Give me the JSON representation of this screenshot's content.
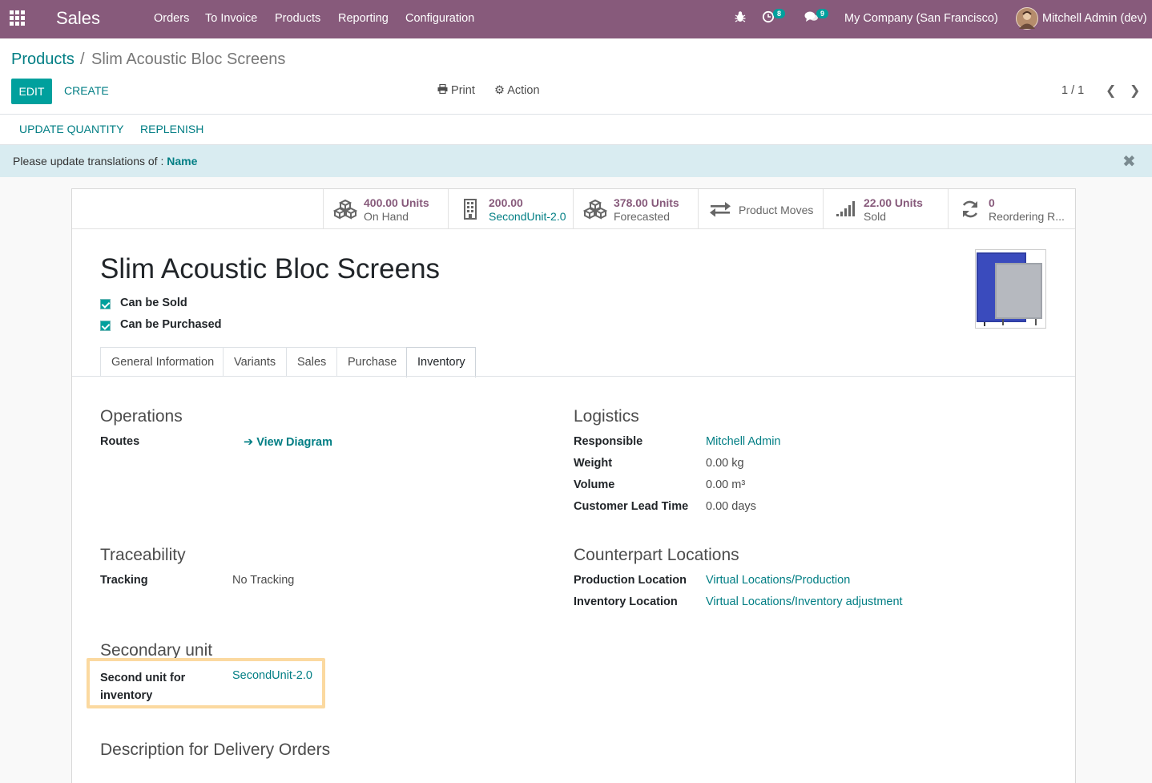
{
  "navbar": {
    "app_name": "Sales",
    "menu": [
      "Orders",
      "To Invoice",
      "Products",
      "Reporting",
      "Configuration"
    ],
    "activity_count": "8",
    "message_count": "9",
    "company": "My Company (San Francisco)",
    "user": "Mitchell Admin (dev)",
    "brand_color": "#875a7b"
  },
  "breadcrumb": {
    "parent": "Products",
    "separator": "/",
    "current": "Slim Acoustic Bloc Screens"
  },
  "toolbar": {
    "edit": "EDIT",
    "create": "CREATE",
    "print": "Print",
    "action": "Action",
    "pager": "1 / 1"
  },
  "statusbar": {
    "update_quantity": "UPDATE QUANTITY",
    "replenish": "REPLENISH"
  },
  "alert": {
    "text": "Please update translations of :",
    "field": "Name",
    "close": "✖"
  },
  "smart_buttons": [
    {
      "value": "400.00 Units",
      "label": "On Hand",
      "icon": "cubes-icon"
    },
    {
      "value": "200.00",
      "label": "SecondUnit-2.0",
      "icon": "building-icon"
    },
    {
      "value": "378.00 Units",
      "label": "Forecasted",
      "icon": "cubes-icon"
    },
    {
      "value": "",
      "label": "Product Moves",
      "icon": "exchange-icon"
    },
    {
      "value": "22.00 Units",
      "label": "Sold",
      "icon": "signal-icon"
    },
    {
      "value": "0",
      "label": "Reordering R...",
      "icon": "refresh-icon"
    }
  ],
  "product": {
    "name": "Slim Acoustic Bloc Screens",
    "can_be_sold": "Can be Sold",
    "can_be_purchased": "Can be Purchased"
  },
  "tabs": [
    "General Information",
    "Variants",
    "Sales",
    "Purchase",
    "Inventory"
  ],
  "active_tab": "Inventory",
  "inventory": {
    "operations": {
      "title": "Operations",
      "routes_label": "Routes",
      "view_diagram": "View Diagram"
    },
    "logistics": {
      "title": "Logistics",
      "responsible_label": "Responsible",
      "responsible": "Mitchell Admin",
      "weight_label": "Weight",
      "weight": "0.00",
      "weight_unit": "kg",
      "volume_label": "Volume",
      "volume": "0.00",
      "volume_unit": "m³",
      "lead_label": "Customer Lead Time",
      "lead": "0.00",
      "lead_unit": "days"
    },
    "traceability": {
      "title": "Traceability",
      "tracking_label": "Tracking",
      "tracking": "No Tracking"
    },
    "counterpart": {
      "title": "Counterpart Locations",
      "production_label": "Production Location",
      "production": "Virtual Locations/Production",
      "inventory_label": "Inventory Location",
      "inventory": "Virtual Locations/Inventory adjustment"
    },
    "secondary": {
      "title": "Secondary unit",
      "label_line1": "Second unit for",
      "label_line2": "inventory",
      "value": "SecondUnit-2.0"
    },
    "delivery_title": "Description for Delivery Orders"
  }
}
